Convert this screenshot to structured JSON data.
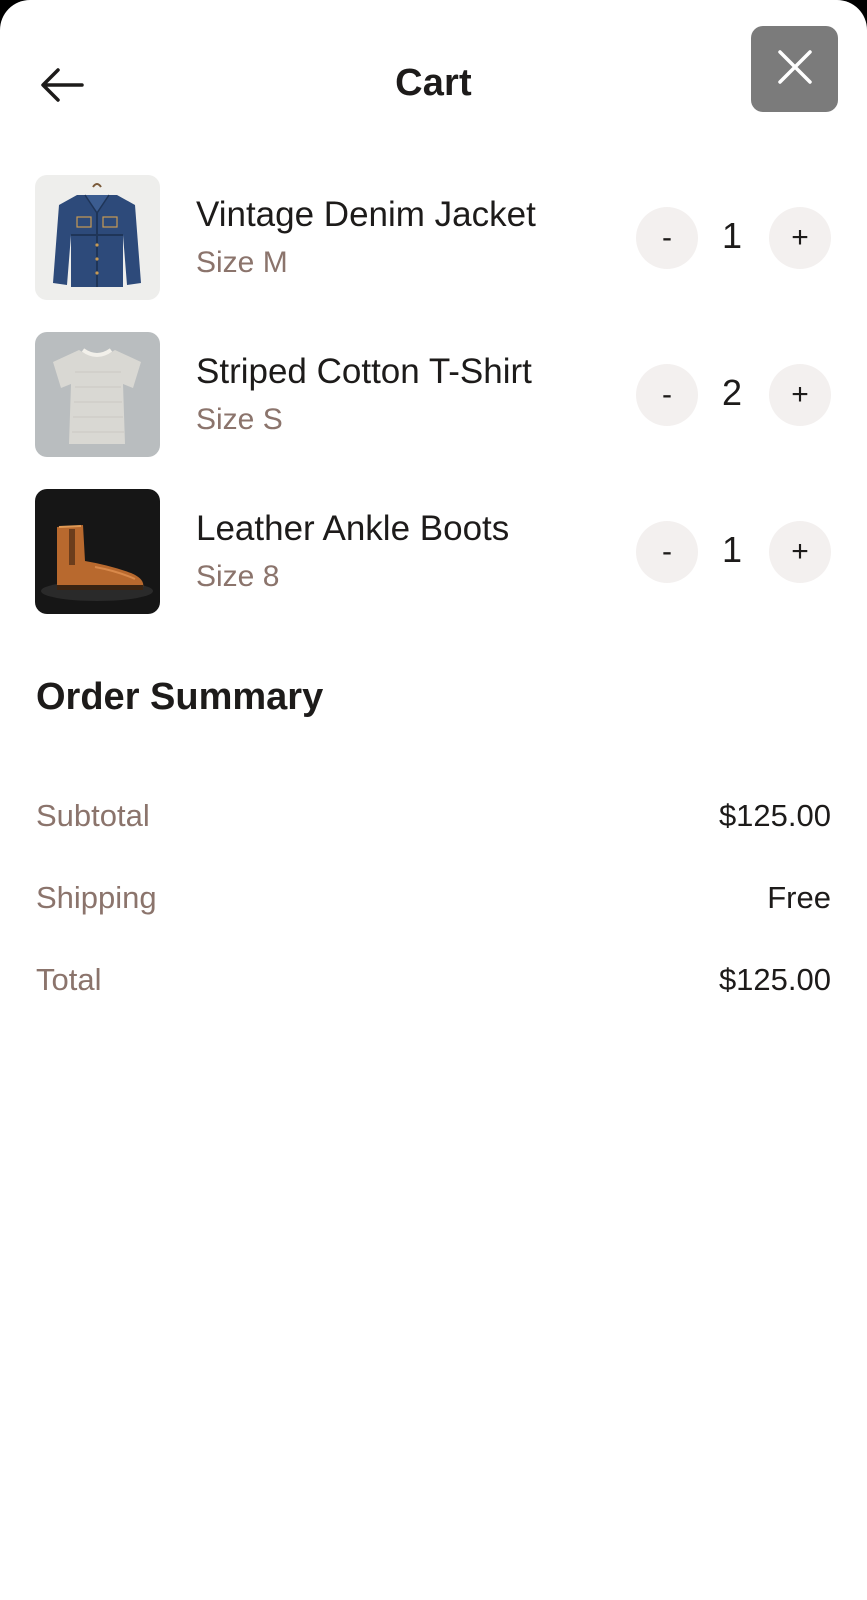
{
  "header": {
    "title": "Cart",
    "back_icon": "arrow-left-icon",
    "close_icon": "close-icon"
  },
  "cart": {
    "items": [
      {
        "name": "Vintage Denim Jacket",
        "size": "Size M",
        "quantity": "1",
        "image": "denim-jacket-image"
      },
      {
        "name": "Striped Cotton T-Shirt",
        "size": "Size S",
        "quantity": "2",
        "image": "t-shirt-image"
      },
      {
        "name": "Leather Ankle Boots",
        "size": "Size 8",
        "quantity": "1",
        "image": "ankle-boots-image"
      }
    ],
    "decrement_label": "-",
    "increment_label": "+"
  },
  "summary": {
    "title": "Order Summary",
    "rows": [
      {
        "label": "Subtotal",
        "value": "$125.00"
      },
      {
        "label": "Shipping",
        "value": "Free"
      },
      {
        "label": "Total",
        "value": "$125.00"
      }
    ]
  },
  "colors": {
    "text_primary": "#1d1b1a",
    "text_secondary": "#8b746c",
    "stepper_bg": "#f3f0ef",
    "close_button_bg": "#7b7b7b"
  }
}
